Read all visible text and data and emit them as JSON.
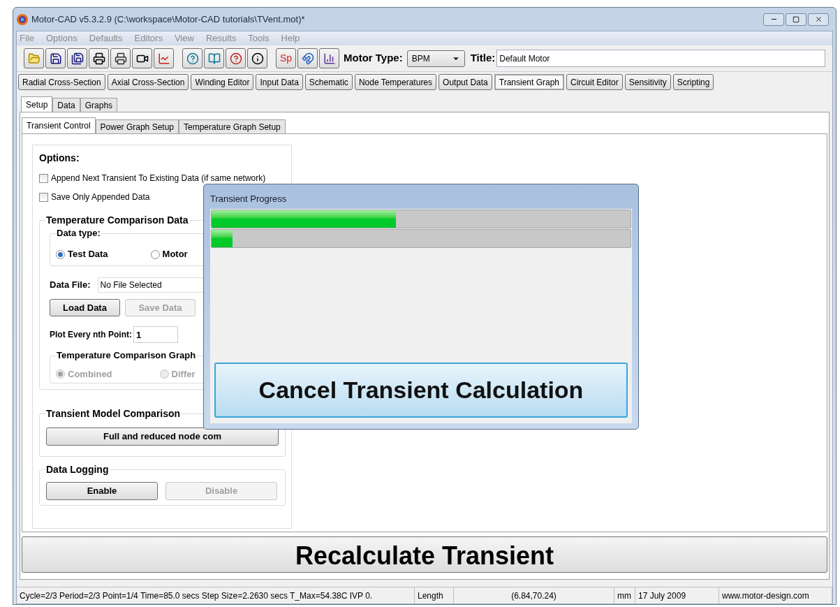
{
  "window": {
    "title": "Motor-CAD v5.3.2.9 (C:\\workspace\\Motor-CAD tutorials\\TVent.mot)*"
  },
  "menu": [
    "File",
    "Options",
    "Defaults",
    "Editors",
    "View",
    "Results",
    "Tools",
    "Help"
  ],
  "toolbar": {
    "sp_button": "Sp",
    "motor_type_label": "Motor Type:",
    "motor_type_value": "BPM",
    "title_label": "Title:",
    "title_value": "Default Motor"
  },
  "main_tabs": [
    {
      "label": "Radial Cross-Section",
      "selected": false
    },
    {
      "label": "Axial Cross-Section",
      "selected": false
    },
    {
      "label": "Winding Editor",
      "selected": false
    },
    {
      "label": "Input Data",
      "selected": false
    },
    {
      "label": "Schematic",
      "selected": false
    },
    {
      "label": "Node Temperatures",
      "selected": false
    },
    {
      "label": "Output Data",
      "selected": false
    },
    {
      "label": "Transient Graph",
      "selected": true
    },
    {
      "label": "Circuit Editor",
      "selected": false
    },
    {
      "label": "Sensitivity",
      "selected": false
    },
    {
      "label": "Scripting",
      "selected": false
    }
  ],
  "sub_tabs": [
    {
      "label": "Setup",
      "selected": true
    },
    {
      "label": "Data",
      "selected": false
    },
    {
      "label": "Graphs",
      "selected": false
    }
  ],
  "inner_tabs": [
    {
      "label": "Transient Control",
      "selected": true
    },
    {
      "label": "Power Graph Setup",
      "selected": false
    },
    {
      "label": "Temperature Graph Setup",
      "selected": false
    }
  ],
  "options": {
    "heading": "Options:",
    "checkboxes": [
      {
        "label": "Append Next Transient To Existing Data (if same network)",
        "checked": false
      },
      {
        "label": "Save Only Appended Data",
        "checked": false
      }
    ]
  },
  "temperature_comparison": {
    "heading": "Temperature Comparison Data",
    "data_type_label": "Data type:",
    "radios": [
      {
        "label": "Test Data",
        "selected": true
      },
      {
        "label": "Motor",
        "selected": false
      }
    ],
    "data_file_label": "Data File:",
    "data_file_value": "No File Selected",
    "buttons": [
      {
        "label": "Load Data",
        "disabled": false
      },
      {
        "label": "Save Data",
        "disabled": true
      }
    ],
    "plot_label": "Plot Every nth Point:",
    "plot_value": "1",
    "graph_heading": "Temperature Comparison Graph",
    "graph_radios": [
      {
        "label": "Combined",
        "selected": true,
        "disabled": true
      },
      {
        "label": "Differ",
        "selected": false,
        "disabled": true
      }
    ]
  },
  "model_comparison": {
    "heading": "Transient Model Comparison",
    "button": "Full and reduced node com"
  },
  "data_logging": {
    "heading": "Data Logging",
    "buttons": [
      {
        "label": "Enable",
        "disabled": false
      },
      {
        "label": "Disable",
        "disabled": true
      }
    ]
  },
  "recalculate_button": "Recalculate Transient",
  "dialog": {
    "title": "Transient Progress",
    "bars": [
      {
        "level": 0.44
      },
      {
        "level": 0.05
      }
    ],
    "cancel_button": "Cancel Transient Calculation"
  },
  "status_bar": [
    "Cycle=2/3  Period=2/3  Point=1/4  Time=85.0 secs  Step Size=2.2630 secs  T_Max=54.38C  IVP 0.",
    "Length",
    "(6.84,70.24)",
    "mm",
    "17 July 2009",
    "www.motor-design.com"
  ]
}
